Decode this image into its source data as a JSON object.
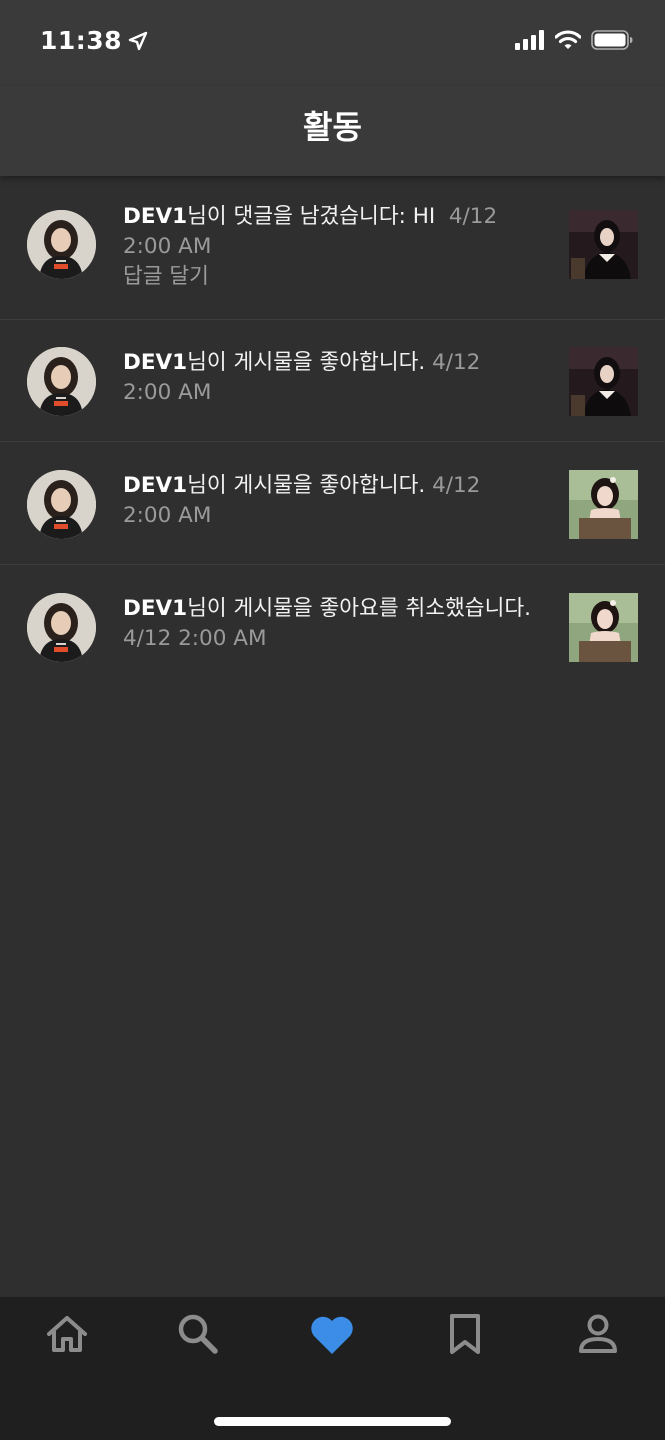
{
  "status_bar": {
    "time": "11:38",
    "icons": [
      "location-arrow-icon",
      "cellular-signal-icon",
      "wifi-icon",
      "battery-icon"
    ]
  },
  "header": {
    "title": "활동"
  },
  "activities": [
    {
      "username": "DEV1",
      "message": "님이 댓글을 남겼습니다: HI",
      "date": "4/12",
      "time": "2:00 AM",
      "reply_label": "답글 달기",
      "thumbnail": "dark-portrait-photo"
    },
    {
      "username": "DEV1",
      "message": "님이 게시물을 좋아합니다.",
      "date": "4/12",
      "time": "2:00 AM",
      "thumbnail": "dark-portrait-photo"
    },
    {
      "username": "DEV1",
      "message": "님이 게시물을 좋아합니다.",
      "date": "4/12",
      "time": "2:00 AM",
      "thumbnail": "green-portrait-photo"
    },
    {
      "username": "DEV1",
      "message": "님이 게시물을 좋아요를 취소했습니다.",
      "date": "4/12",
      "time": "2:00 AM",
      "thumbnail": "green-portrait-photo"
    }
  ],
  "tab_bar": {
    "tabs": [
      {
        "icon": "home-icon",
        "active": false
      },
      {
        "icon": "search-icon",
        "active": false
      },
      {
        "icon": "heart-icon",
        "active": true
      },
      {
        "icon": "bookmark-icon",
        "active": false
      },
      {
        "icon": "profile-icon",
        "active": false
      }
    ],
    "active_color": "#3b8de8",
    "inactive_color": "#8c8c8c"
  }
}
